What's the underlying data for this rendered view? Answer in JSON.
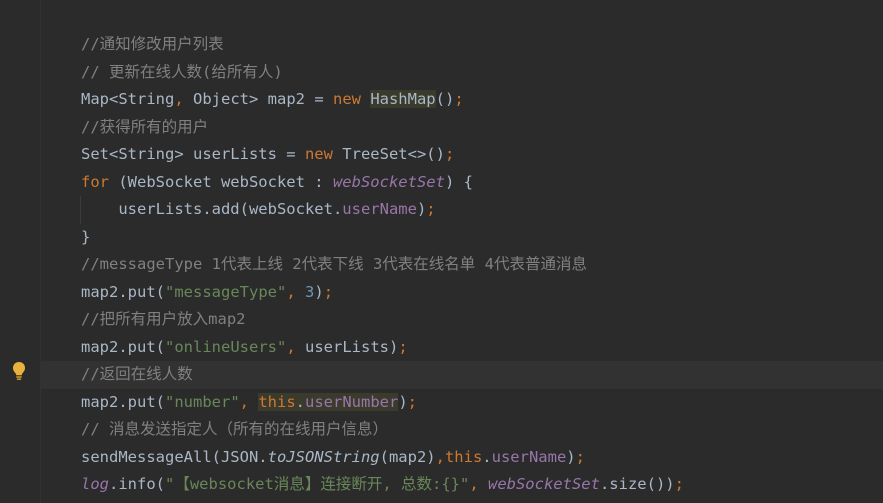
{
  "editor": {
    "lines": [
      {
        "id": "l1",
        "tokens": [
          {
            "t": "//通知修改用户列表",
            "c": "comment"
          }
        ]
      },
      {
        "id": "l2",
        "tokens": [
          {
            "t": "// 更新在线人数(给所有人)",
            "c": "comment"
          }
        ]
      },
      {
        "id": "l3",
        "tokens": [
          {
            "t": "Map<String",
            "c": "plain"
          },
          {
            "t": ",",
            "c": "kw"
          },
          {
            "t": " Object> map2 = ",
            "c": "plain"
          },
          {
            "t": "new ",
            "c": "kw"
          },
          {
            "t": "HashMap",
            "c": "plain-hl"
          },
          {
            "t": "()",
            "c": "plain"
          },
          {
            "t": ";",
            "c": "kw"
          }
        ]
      },
      {
        "id": "l4",
        "tokens": [
          {
            "t": "//获得所有的用户",
            "c": "comment"
          }
        ]
      },
      {
        "id": "l5",
        "tokens": [
          {
            "t": "Set<String> userLists = ",
            "c": "plain"
          },
          {
            "t": "new ",
            "c": "kw"
          },
          {
            "t": "TreeSet<>()",
            "c": "plain"
          },
          {
            "t": ";",
            "c": "kw"
          }
        ]
      },
      {
        "id": "l6",
        "tokens": [
          {
            "t": "for ",
            "c": "kw"
          },
          {
            "t": "(WebSocket webSocket : ",
            "c": "plain"
          },
          {
            "t": "webSocketSet",
            "c": "static"
          },
          {
            "t": ") {",
            "c": "plain"
          }
        ]
      },
      {
        "id": "l7",
        "indent": true,
        "tokens": [
          {
            "t": "    userLists.add(webSocket.",
            "c": "plain"
          },
          {
            "t": "userName",
            "c": "field"
          },
          {
            "t": ")",
            "c": "plain"
          },
          {
            "t": ";",
            "c": "kw"
          }
        ]
      },
      {
        "id": "l8",
        "tokens": [
          {
            "t": "}",
            "c": "plain"
          }
        ]
      },
      {
        "id": "l9",
        "tokens": [
          {
            "t": "//messageType 1代表上线 2代表下线 3代表在线名单 4代表普通消息",
            "c": "comment"
          }
        ]
      },
      {
        "id": "l10",
        "tokens": [
          {
            "t": "map2.put(",
            "c": "plain"
          },
          {
            "t": "\"messageType\"",
            "c": "str"
          },
          {
            "t": ", ",
            "c": "kw"
          },
          {
            "t": "3",
            "c": "num"
          },
          {
            "t": ")",
            "c": "plain"
          },
          {
            "t": ";",
            "c": "kw"
          }
        ]
      },
      {
        "id": "l11",
        "tokens": [
          {
            "t": "//把所有用户放入map2",
            "c": "comment"
          }
        ]
      },
      {
        "id": "l12",
        "tokens": [
          {
            "t": "map2.put(",
            "c": "plain"
          },
          {
            "t": "\"onlineUsers\"",
            "c": "str"
          },
          {
            "t": ", ",
            "c": "kw"
          },
          {
            "t": "userLists)",
            "c": "plain"
          },
          {
            "t": ";",
            "c": "kw"
          }
        ]
      },
      {
        "id": "l13",
        "current": true,
        "tokens": [
          {
            "t": "//返回在线人数",
            "c": "comment"
          }
        ]
      },
      {
        "id": "l14",
        "tokens": [
          {
            "t": "map2.put(",
            "c": "plain"
          },
          {
            "t": "\"number\"",
            "c": "str"
          },
          {
            "t": ", ",
            "c": "kw"
          },
          {
            "t": "this",
            "c": "kw-hl"
          },
          {
            "t": ".",
            "c": "plain-hl"
          },
          {
            "t": "userNumber",
            "c": "field-hl"
          },
          {
            "t": ")",
            "c": "plain"
          },
          {
            "t": ";",
            "c": "kw"
          }
        ]
      },
      {
        "id": "l15",
        "tokens": [
          {
            "t": "// 消息发送指定人（所有的在线用户信息）",
            "c": "comment"
          }
        ]
      },
      {
        "id": "l16",
        "tokens": [
          {
            "t": "sendMessageAll(JSON.",
            "c": "plain"
          },
          {
            "t": "toJSONString",
            "c": "italic-m"
          },
          {
            "t": "(map2)",
            "c": "plain"
          },
          {
            "t": ",",
            "c": "kw"
          },
          {
            "t": "this",
            "c": "kw"
          },
          {
            "t": ".",
            "c": "plain"
          },
          {
            "t": "userName",
            "c": "field"
          },
          {
            "t": ")",
            "c": "plain"
          },
          {
            "t": ";",
            "c": "kw"
          }
        ]
      },
      {
        "id": "l17",
        "tokens": [
          {
            "t": "log",
            "c": "static"
          },
          {
            "t": ".info(",
            "c": "plain"
          },
          {
            "t": "\"【websocket消息】连接断开, 总数:{}\"",
            "c": "str"
          },
          {
            "t": ", ",
            "c": "kw"
          },
          {
            "t": "webSocketSet",
            "c": "static"
          },
          {
            "t": ".size())",
            "c": "plain"
          },
          {
            "t": ";",
            "c": "kw"
          }
        ]
      }
    ]
  },
  "gutter": {
    "intention_icon": "lightbulb-icon",
    "bulb_color": "#e8b33a"
  },
  "colors": {
    "background": "#2b2b2b",
    "current_line": "#323232",
    "keyword": "#cc7832",
    "string": "#6a8759",
    "number": "#6897bb",
    "comment": "#808080",
    "field": "#9876aa",
    "text": "#a9b7c6"
  }
}
